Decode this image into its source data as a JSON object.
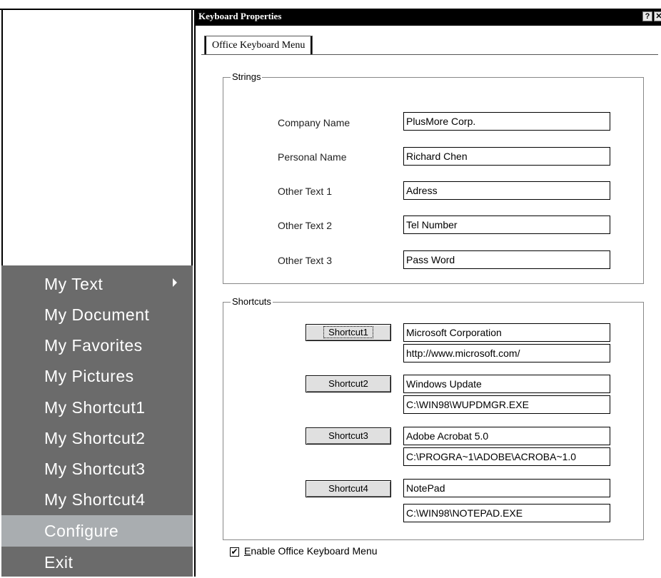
{
  "menu": {
    "items": [
      {
        "label": "My Text",
        "has_submenu": true
      },
      {
        "label": "My Document"
      },
      {
        "label": "My Favorites"
      },
      {
        "label": "My Pictures"
      },
      {
        "label": "My Shortcut1"
      },
      {
        "label": "My Shortcut2"
      },
      {
        "label": "My Shortcut3"
      },
      {
        "label": "My Shortcut4"
      },
      {
        "label": "Configure",
        "selected": true
      },
      {
        "label": "Exit"
      }
    ],
    "bg_color": "#6b6b6b",
    "selected_color": "#a9adb0"
  },
  "dialog": {
    "title": "Keyboard Properties",
    "help_icon": "?",
    "close_icon": "✕",
    "tab_label": "Office Keyboard Menu",
    "strings_group": {
      "title": "Strings",
      "fields": [
        {
          "label": "Company Name",
          "value": "PlusMore Corp."
        },
        {
          "label": "Personal Name",
          "value": "Richard Chen"
        },
        {
          "label": "Other Text 1",
          "value": "Adress"
        },
        {
          "label": "Other Text 2",
          "value": "Tel Number"
        },
        {
          "label": "Other Text 3",
          "value": "Pass Word"
        }
      ]
    },
    "shortcuts_group": {
      "title": "Shortcuts",
      "items": [
        {
          "button": "Shortcut1",
          "name": "Microsoft Corporation",
          "path": "http://www.microsoft.com/"
        },
        {
          "button": "Shortcut2",
          "name": "Windows Update",
          "path": "C:\\WIN98\\WUPDMGR.EXE"
        },
        {
          "button": "Shortcut3",
          "name": "Adobe Acrobat 5.0",
          "path": "C:\\PROGRA~1\\ADOBE\\ACROBA~1.0"
        },
        {
          "button": "Shortcut4",
          "name": "NotePad",
          "path": "C:\\WIN98\\NOTEPAD.EXE"
        }
      ]
    },
    "enable_checkbox": {
      "checked": true,
      "label_accel": "E",
      "label_rest": "nable Office Keyboard Menu"
    }
  }
}
